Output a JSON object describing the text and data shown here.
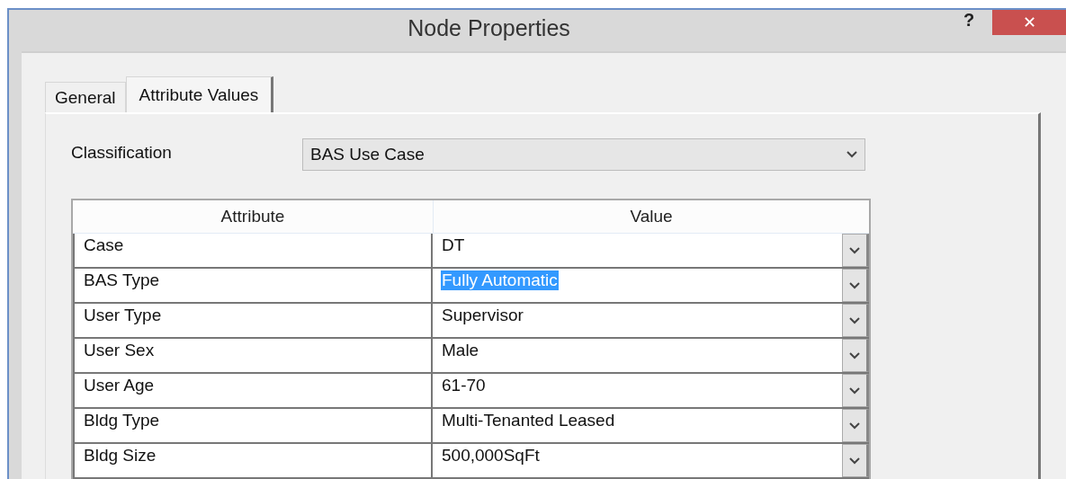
{
  "window": {
    "title": "Node Properties",
    "help": "?",
    "close": "✕"
  },
  "tabs": [
    {
      "label": "General",
      "selected": false
    },
    {
      "label": "Attribute Values",
      "selected": true
    }
  ],
  "classification": {
    "label": "Classification",
    "value": "BAS Use Case"
  },
  "table": {
    "columns": [
      "Attribute",
      "Value"
    ],
    "rows": [
      {
        "attribute": "Case",
        "value": "DT",
        "selected": false
      },
      {
        "attribute": "BAS Type",
        "value": "Fully Automatic",
        "selected": true
      },
      {
        "attribute": "User Type",
        "value": "Supervisor",
        "selected": false
      },
      {
        "attribute": "User Sex",
        "value": "Male",
        "selected": false
      },
      {
        "attribute": "User Age",
        "value": "61-70",
        "selected": false
      },
      {
        "attribute": "Bldg Type",
        "value": "Multi-Tenanted Leased",
        "selected": false
      },
      {
        "attribute": "Bldg Size",
        "value": "500,000SqFt",
        "selected": false
      }
    ]
  }
}
